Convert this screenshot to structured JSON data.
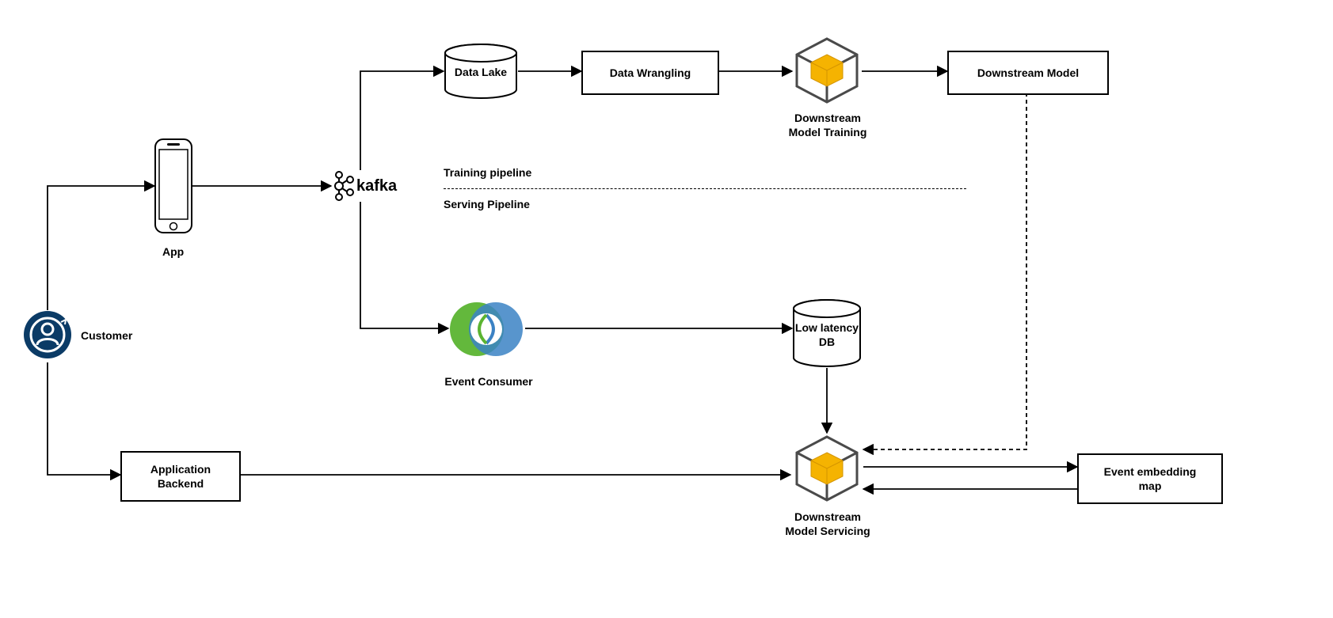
{
  "nodes": {
    "customer": {
      "label": "Customer"
    },
    "app": {
      "label": "App"
    },
    "kafka": {
      "label": "kafka"
    },
    "data_lake": {
      "label": "Data Lake"
    },
    "data_wrangling": {
      "label": "Data Wrangling"
    },
    "model_training": {
      "label": "Downstream\nModel Training"
    },
    "downstream_model": {
      "label": "Downstream Model"
    },
    "event_consumer": {
      "label": "Event Consumer"
    },
    "low_latency_db": {
      "label": "Low latency\nDB"
    },
    "model_servicing": {
      "label": "Downstream\nModel Servicing"
    },
    "app_backend": {
      "label": "Application\nBackend"
    },
    "event_embedding_map": {
      "label": "Event embedding\nmap"
    }
  },
  "sections": {
    "training": "Training pipeline",
    "serving": "Serving Pipeline"
  }
}
